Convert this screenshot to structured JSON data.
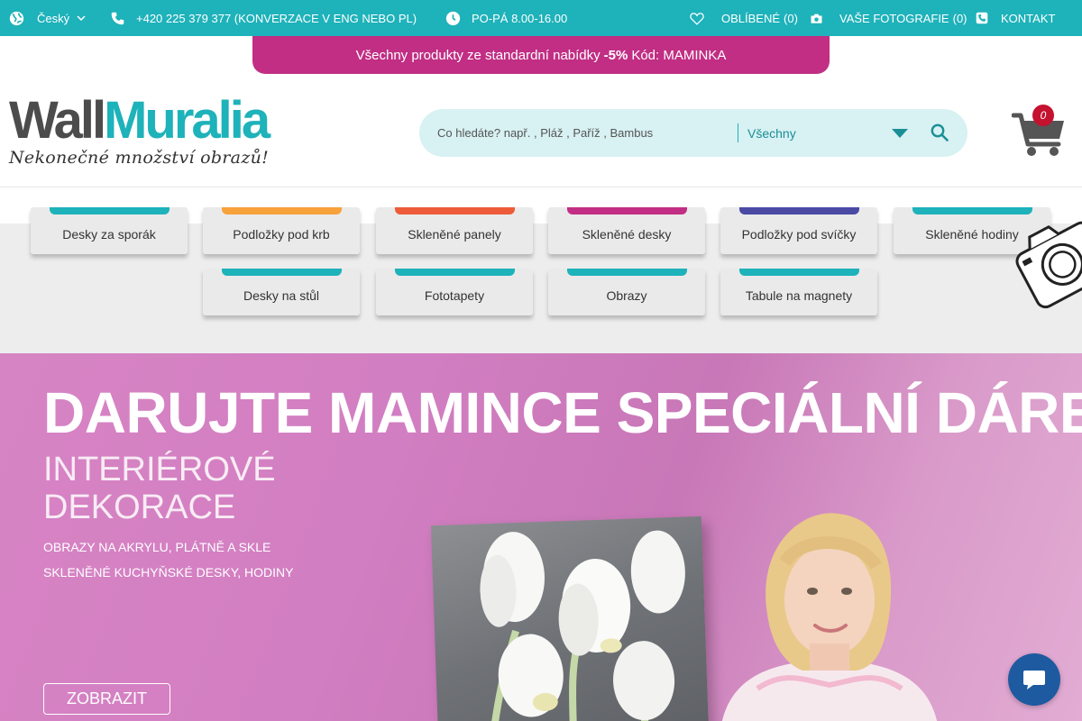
{
  "topbar": {
    "language": "Český",
    "phone": "+420 225 379 377 (KONVERZACE V ENG NEBO PL)",
    "hours": "PO-PÁ 8.00-16.00",
    "favorites_label": "OBLÍBENÉ",
    "favorites_count": "(0)",
    "photos_label": "VAŠE FOTOGRAFIE",
    "photos_count": "(0)",
    "contact": "KONTAKT"
  },
  "promo": {
    "text": "Všechny produkty ze standardní nabídky",
    "discount": "-5%",
    "code": "Kód: MAMINKA"
  },
  "logo": {
    "part1": "Wall",
    "part2": "Muralia",
    "tagline": "Nekonečné množství obrazů!"
  },
  "search": {
    "placeholder": "Co hledáte? např. , Pláž , Paříž , Bambus",
    "category": "Všechny"
  },
  "cart": {
    "count": "0"
  },
  "categories": [
    {
      "label": "Desky za sporák",
      "color": "#1eb2ba"
    },
    {
      "label": "Podložky pod krb",
      "color": "#f7a23a"
    },
    {
      "label": "Skleněné panely",
      "color": "#ee5b3a"
    },
    {
      "label": "Skleněné desky",
      "color": "#c12e84"
    },
    {
      "label": "Podložky pod svíčky",
      "color": "#4a4aa5"
    },
    {
      "label": "Skleněné hodiny",
      "color": "#1eb2ba"
    },
    {
      "label": "Desky na stůl",
      "color": "#1eb2ba"
    },
    {
      "label": "Fototapety",
      "color": "#1eb2ba"
    },
    {
      "label": "Obrazy",
      "color": "#1eb2ba"
    },
    {
      "label": "Tabule na magnety",
      "color": "#1eb2ba"
    }
  ],
  "hero": {
    "headline": "DARUJTE MAMINCE SPECIÁLNÍ DÁREK!",
    "subheadline": "INTERIÉROVÉ DEKORACE",
    "line1": "OBRAZY NA AKRYLU, PLÁTNĚ A SKLE",
    "line2": "SKLENĚNÉ KUCHYŇSKÉ DESKY, HODINY",
    "cta": "ZOBRAZIT"
  },
  "colors": {
    "teal": "#1eb2ba",
    "magenta": "#c12e84",
    "hero_pink": "#d27ec2",
    "chat_blue": "#1e5aa0"
  }
}
